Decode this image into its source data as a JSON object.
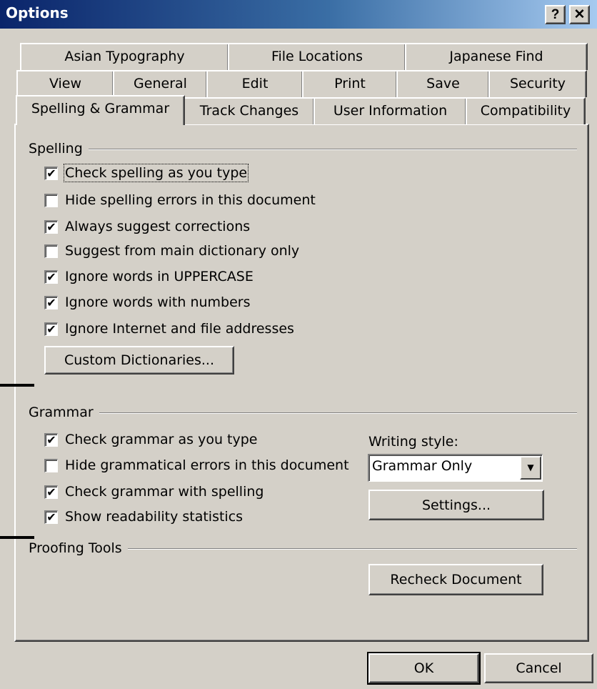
{
  "window": {
    "title": "Options",
    "help_label": "?",
    "close_label": "✕"
  },
  "tabs": {
    "row1": [
      "Asian Typography",
      "File Locations",
      "Japanese Find"
    ],
    "row2": [
      "View",
      "General",
      "Edit",
      "Print",
      "Save",
      "Security"
    ],
    "row3": [
      "Spelling & Grammar",
      "Track Changes",
      "User Information",
      "Compatibility"
    ],
    "active": "Spelling & Grammar"
  },
  "spelling": {
    "label": "Spelling",
    "options": [
      {
        "label": "Check spelling as you type",
        "checked": true
      },
      {
        "label": "Hide spelling errors in this document",
        "checked": false
      },
      {
        "label": "Always suggest corrections",
        "checked": true
      },
      {
        "label": "Suggest from main dictionary only",
        "checked": false
      },
      {
        "label": "Ignore words in UPPERCASE",
        "checked": true
      },
      {
        "label": "Ignore words with numbers",
        "checked": true
      },
      {
        "label": "Ignore Internet and file addresses",
        "checked": true
      }
    ],
    "custom_dictionaries_label": "Custom Dictionaries..."
  },
  "grammar": {
    "label": "Grammar",
    "options": [
      {
        "label": "Check grammar as you type",
        "checked": true
      },
      {
        "label": "Hide grammatical errors in this document",
        "checked": false
      },
      {
        "label": "Check grammar with spelling",
        "checked": true
      },
      {
        "label": "Show readability statistics",
        "checked": true
      }
    ],
    "writing_style_label": "Writing style:",
    "writing_style_value": "Grammar Only",
    "settings_label": "Settings..."
  },
  "proofing": {
    "label": "Proofing Tools",
    "recheck_label": "Recheck Document"
  },
  "footer": {
    "ok_label": "OK",
    "cancel_label": "Cancel"
  },
  "icons": {
    "checkmark": "✔",
    "dropdown": "▼"
  }
}
